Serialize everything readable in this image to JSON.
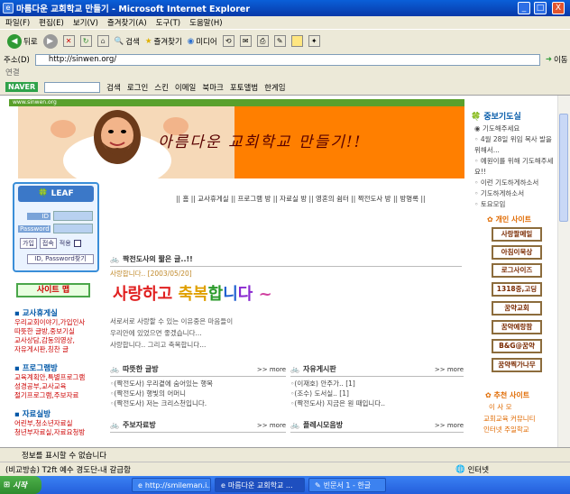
{
  "window": {
    "title": "마름다운 교회학교 만들기 - Microsoft Internet Explorer",
    "min_label": "_",
    "max_label": "□",
    "close_label": "X"
  },
  "menu": [
    "파일(F)",
    "편집(E)",
    "보기(V)",
    "즐겨찾기(A)",
    "도구(T)",
    "도움말(H)"
  ],
  "toolbar": {
    "back": "뒤로",
    "search": "검색",
    "favorites": "즐겨찾기",
    "media": "미디어"
  },
  "address": {
    "label": "주소(D)",
    "url": "http://sinwen.org/",
    "go_label": "이동"
  },
  "links_label": "연결",
  "naver": {
    "logo": "NAVER",
    "search": "검색",
    "login": "로그인",
    "skin": "스킨",
    "email": "이메일",
    "bookmark": "북마크",
    "photo": "포토앨범",
    "hangul": "한게임"
  },
  "page": {
    "strip_text": "www.sinwen.org",
    "banner_title": "아름다운 교회학교 만들기!!",
    "login": {
      "title": "LEAF",
      "id_label": "ID",
      "pw_label": "Password",
      "join": "가입",
      "connect": "접속",
      "auto": "적용",
      "find": "ID, Password찾기"
    },
    "sitemap": "사이트 맵",
    "nav_sections": [
      {
        "head": "교사휴게실",
        "items": [
          "우리교회이야기,가입인사",
          "따뜻한 글방,중보기실",
          "교사상담,감동의영상,",
          "자유게시판,칭찬 글"
        ]
      },
      {
        "head": "프로그램방",
        "items": [
          "교육계획안,특별프로그램",
          "성경공부,교사교육",
          "절기프로그램,주보자료"
        ]
      },
      {
        "head": "자료실방",
        "items": [
          "어린부,청소년자료실",
          "청년부자료실,자료요청방"
        ]
      }
    ],
    "top_nav": "|| 홈 || 교사휴게실 || 프로그램 방 || 자료실 방 || 영혼의 쉼터 || 짝전도사 방 || 방명록 ||",
    "post": {
      "section": "짝전도사의 짧은 글..!!",
      "meta": "사랑합니다..                [2003/05/20]",
      "big_text": "사랑하고 축복합니다 ~",
      "lines": [
        "서로서로 사랑할 수 있는 이유중은 마음들이",
        "우리안에 있었으면 좋겠습니다...",
        "사랑합니다.. 그리고 축복합니다..."
      ]
    },
    "warm": {
      "title": "따뜻한 글방",
      "items": [
        "◦(짝전도사) 우리곁에 숨어있는 행복",
        "◦(짝전도사) 행빛의 어머니",
        "◦(짝전도사) 저는 크리스천입니다."
      ]
    },
    "free": {
      "title": "자유게시판",
      "items": [
        "◦(이재호) 안주가.. [1]",
        "◦(조수) 도서실.. [1]",
        "◦(짝전도사) 지금은 원 때입니다.."
      ]
    },
    "bulletin": {
      "title": "주보자료방"
    },
    "class": {
      "title": "플레시모음방"
    },
    "more_label": ">> more"
  },
  "right": {
    "title1": "중보기도실",
    "items1": [
      "기도해주세요",
      "4월 28일 위임 목사 발을 위해서...",
      "예원이를 위해 기도해주세요!!",
      "이런 기도하게하소서",
      "기도하게하소서",
      "토요모임"
    ],
    "title2": "개인 사이트",
    "sites": [
      "사랑팔메일",
      "아침이묵상",
      "로그사이즈",
      "1318중,고딩",
      "꿈약교회",
      "꿈약예랑팜",
      "B&G@꿈약",
      "꿈약찍가나무"
    ],
    "title3": "추천 사이트",
    "sub3": "이 사 모",
    "items3": [
      "교회교육 커뮤니티",
      "인터넷 주일학교"
    ]
  },
  "status": {
    "message": "정보를 표시할 수 없습니다",
    "bottom": "(비교방송) T2ft 예수 경도단-내 갈급함",
    "zone": "인터넷"
  },
  "taskbar": {
    "start": "시작",
    "tasks": [
      "http://smileman.i...",
      "마름다운 교회학교 ...",
      "빈문서 1 - 한글"
    ]
  },
  "colors": {
    "title_blue": "#0839a8",
    "banner_orange": "#ff7f00",
    "strip_green": "#5aa02c"
  }
}
